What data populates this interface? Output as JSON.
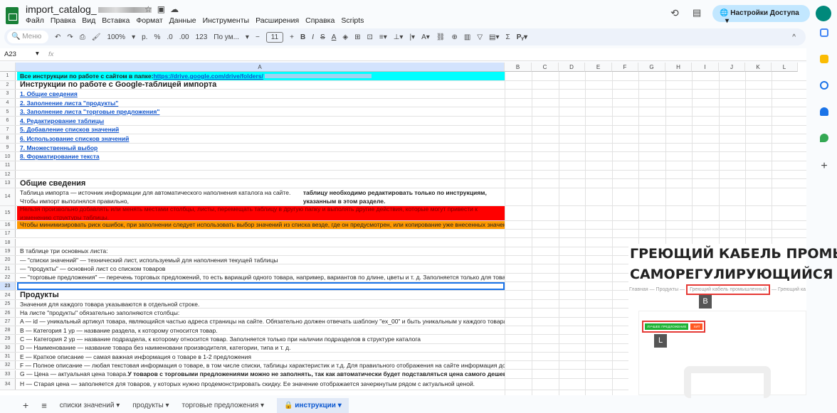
{
  "app": {
    "title": "import_catalog_",
    "menu": [
      "Файл",
      "Правка",
      "Вид",
      "Вставка",
      "Формат",
      "Данные",
      "Инструменты",
      "Расширения",
      "Справка",
      "Scripts"
    ],
    "share_label": "Настройки Доступа"
  },
  "toolbar": {
    "search_placeholder": "Меню",
    "zoom": "100%",
    "currency": "р.",
    "percent": "%",
    "dec_less": ".0",
    "dec_more": ".00",
    "number_format": "123",
    "font": "По ум...",
    "font_size": "11",
    "bold": "B",
    "italic": "I",
    "func": "Σ"
  },
  "formula_bar": {
    "cell_ref": "A23",
    "fx": "fx"
  },
  "columns": [
    "A",
    "B",
    "C",
    "D",
    "E",
    "F",
    "G",
    "H",
    "I",
    "J",
    "K",
    "L"
  ],
  "rows": {
    "r1_prefix": "Все инструкции по работе с сайтом в папке: ",
    "r1_link": "https://drive.google.com/drive/folders/",
    "r2": "Инструкции по работе с Google-таблицей импорта",
    "toc": [
      "1. Общие сведения",
      "2. Заполнение листа \"продукты\"",
      "3. Заполнение листа \"торговые предложения\"",
      "4. Редактирование таблицы",
      "5. Добавление списков значений",
      "6. Использование списков значений",
      "7. Множественный выбор",
      "8. Форматирование текста"
    ],
    "r13": "Общие сведения",
    "r14a": "Таблица импорта — источник информации для автоматического наполнения каталога на сайте. Чтобы импорт выполнялся правильно, ",
    "r14b": "таблицу необходимо редактировать только по инструкциям, указанным в этом разделе.",
    "r15": "Нельзя произвольно добавлять или менять местами столбцы, листы, перемещать таблицу в другую папку и выполять другие действия, которые могут привести к изменению структуры таблицы.",
    "r16": "Чтобы минимизировать риск ошибок, при заполнении следует использовать выбор значений из списка везде, где он предусмотрен, или копирование уже внесенных значений",
    "r19": "В таблице три основных листа:",
    "r20": "— \"списки значений\" — технический лист, используемый для наполнения текущей таблицы",
    "r21": "— \"продукты\" — основной лист со списком товаров",
    "r22": "— \"торговые предложения\" — перечень торговых предложений, то есть вариаций одного товара, например, вариантов по длине, цветы и т. д. Заполняется только для товаров, у которых есть такие вариации",
    "r24": "Продукты",
    "r25": "Значения для каждого товара указываются в отдельной строке.",
    "r26": "На листе \"продукты\" обязательно заполняются столбцы:",
    "r27": "A — id — уникальный артикул товара, являющийся частью адреса страницы на сайте. Обязательно должен отвечать шаблону \"ex_00\" и быть уникальным у каждого товара",
    "r28": "B — Категория 1 ур — название раздела, к которому относится товар.",
    "r29": "C — Категория 2 ур — название подраздела, к которому относится товар. Заполняется только при наличии подразделов в структуре каталога",
    "r30": "D — Наименование — название товара без наименовани производителя, категории, типа и т. д.",
    "r31": "E — Краткое описание — самая важная информация о товаре в 1-2 предложения",
    "r32": "F — Полное описание — любая текстовая информация о товаре, в том числе списки, таблицы характеристик и т.д. Для правильного отображения на сайте информация должна быть представлена в виде html-кода.",
    "r33a": "G — Цена — актуальная цена товара. ",
    "r33b": "У товаров с торговыми предложениями можно не заполнять, так как автоматически будет подставляться цена самого дешевого торгового предложения.",
    "r34": "H — Старая цена — заполняется для товаров, у которых нужно продемонстрировать скидку. Ее значение отображается зачеркнутым рядом с актуальной ценой."
  },
  "overlay": {
    "heading1": "ГРЕЮЩИЙ КАБЕЛЬ ПРОМЫШЛ",
    "heading2": "САМОРЕГУЛИРУЮЩИЙСЯ",
    "crumbs": [
      "Главная",
      "Продукты",
      "Греющий кабель промышленный",
      "Греющий ка"
    ],
    "label_b": "B",
    "label_l": "L",
    "badge_best": "ЛУЧШЕЕ ПРЕДЛОЖЕНИЕ",
    "badge_hit": "ХИТ"
  },
  "sheets": [
    "списки значений",
    "продукты",
    "торговые предложения",
    "инструкции"
  ]
}
